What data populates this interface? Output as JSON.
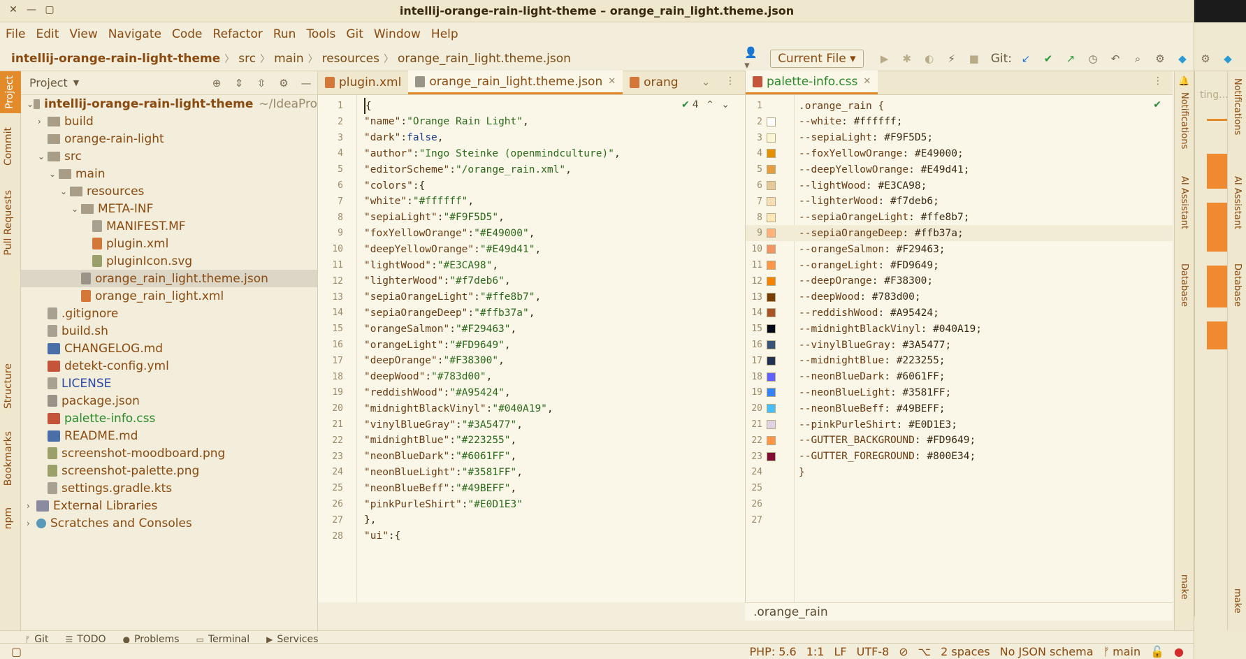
{
  "window": {
    "title": "intellij-orange-rain-light-theme – orange_rain_light.theme.json"
  },
  "menu": [
    "File",
    "Edit",
    "View",
    "Navigate",
    "Code",
    "Refactor",
    "Run",
    "Tools",
    "Git",
    "Window",
    "Help"
  ],
  "breadcrumb": {
    "project": "intellij-orange-rain-light-theme",
    "parts": [
      "src",
      "main",
      "resources"
    ],
    "file": "orange_rain_light.theme.json"
  },
  "toolbar": {
    "run_config": "Current File",
    "git_label": "Git:"
  },
  "left_stripe": [
    "Project",
    "Commit",
    "Pull Requests",
    "Structure",
    "Bookmarks",
    "npm"
  ],
  "project_panel": {
    "title": "Project",
    "rows": [
      {
        "depth": 0,
        "arrow": "v",
        "icon": "folder",
        "label": "intellij-orange-rain-light-theme",
        "suffix": "~/IdeaPro",
        "cls": "tl-brown tl-bold"
      },
      {
        "depth": 1,
        "arrow": ">",
        "icon": "folder",
        "label": "build",
        "cls": "tl-brown"
      },
      {
        "depth": 1,
        "arrow": "",
        "icon": "folder",
        "label": "orange-rain-light",
        "cls": "tl-brown"
      },
      {
        "depth": 1,
        "arrow": "v",
        "icon": "folder",
        "label": "src",
        "cls": "tl-brown"
      },
      {
        "depth": 2,
        "arrow": "v",
        "icon": "folder",
        "label": "main",
        "cls": "tl-brown"
      },
      {
        "depth": 3,
        "arrow": "v",
        "icon": "folder",
        "label": "resources",
        "cls": "tl-brown"
      },
      {
        "depth": 4,
        "arrow": "v",
        "icon": "folder",
        "label": "META-INF",
        "cls": "tl-brown"
      },
      {
        "depth": 5,
        "arrow": "",
        "icon": "file",
        "label": "MANIFEST.MF",
        "cls": "tl-brown"
      },
      {
        "depth": 5,
        "arrow": "",
        "icon": "xml",
        "label": "plugin.xml",
        "cls": "tl-brown"
      },
      {
        "depth": 5,
        "arrow": "",
        "icon": "img",
        "label": "pluginIcon.svg",
        "cls": "tl-brown"
      },
      {
        "depth": 4,
        "arrow": "",
        "icon": "json",
        "label": "orange_rain_light.theme.json",
        "cls": "tl-brown",
        "selected": true
      },
      {
        "depth": 4,
        "arrow": "",
        "icon": "xml",
        "label": "orange_rain_light.xml",
        "cls": "tl-brown"
      },
      {
        "depth": 1,
        "arrow": "",
        "icon": "file",
        "label": ".gitignore",
        "cls": "tl-brown"
      },
      {
        "depth": 1,
        "arrow": "",
        "icon": "file",
        "label": "build.sh",
        "cls": "tl-brown"
      },
      {
        "depth": 1,
        "arrow": "",
        "icon": "md",
        "label": "CHANGELOG.md",
        "cls": "tl-brown"
      },
      {
        "depth": 1,
        "arrow": "",
        "icon": "yml",
        "label": "detekt-config.yml",
        "cls": "tl-brown"
      },
      {
        "depth": 1,
        "arrow": "",
        "icon": "file",
        "label": "LICENSE",
        "cls": "tl-blue"
      },
      {
        "depth": 1,
        "arrow": "",
        "icon": "json",
        "label": "package.json",
        "cls": "tl-brown"
      },
      {
        "depth": 1,
        "arrow": "",
        "icon": "css",
        "label": "palette-info.css",
        "cls": "tl-green"
      },
      {
        "depth": 1,
        "arrow": "",
        "icon": "md",
        "label": "README.md",
        "cls": "tl-brown"
      },
      {
        "depth": 1,
        "arrow": "",
        "icon": "img",
        "label": "screenshot-moodboard.png",
        "cls": "tl-brown"
      },
      {
        "depth": 1,
        "arrow": "",
        "icon": "img",
        "label": "screenshot-palette.png",
        "cls": "tl-brown"
      },
      {
        "depth": 1,
        "arrow": "",
        "icon": "file",
        "label": "settings.gradle.kts",
        "cls": "tl-brown"
      },
      {
        "depth": 0,
        "arrow": ">",
        "icon": "lib",
        "label": "External Libraries",
        "cls": "tl-brown"
      },
      {
        "depth": 0,
        "arrow": ">",
        "icon": "scr",
        "label": "Scratches and Consoles",
        "cls": "tl-brown"
      }
    ]
  },
  "left_editor": {
    "tabs": [
      {
        "label": "plugin.xml",
        "icon": "#d4783a",
        "active": false,
        "close": false
      },
      {
        "label": "orange_rain_light.theme.json",
        "icon": "#9a9488",
        "active": true,
        "close": true
      },
      {
        "label": "orang",
        "icon": "#d4783a",
        "active": false,
        "close": false
      }
    ],
    "inspection_count": "4",
    "lines": [
      {
        "n": "1",
        "t": "{"
      },
      {
        "n": "2",
        "t": "  \"name\": \"Orange Rain Light\","
      },
      {
        "n": "3",
        "t": "  \"dark\": false,"
      },
      {
        "n": "4",
        "t": "  \"author\": \"Ingo Steinke (openmindculture)\","
      },
      {
        "n": "5",
        "t": "  \"editorScheme\": \"/orange_rain.xml\","
      },
      {
        "n": "6",
        "t": "  \"colors\": {"
      },
      {
        "n": "7",
        "t": "    \"white\": \"#ffffff\","
      },
      {
        "n": "8",
        "t": "    \"sepiaLight\": \"#F9F5D5\","
      },
      {
        "n": "9",
        "t": "    \"foxYellowOrange\": \"#E49000\","
      },
      {
        "n": "10",
        "t": "    \"deepYellowOrange\": \"#E49d41\","
      },
      {
        "n": "11",
        "t": "    \"lightWood\": \"#E3CA98\","
      },
      {
        "n": "12",
        "t": "    \"lighterWood\": \"#f7deb6\","
      },
      {
        "n": "13",
        "t": "    \"sepiaOrangeLight\": \"#ffe8b7\","
      },
      {
        "n": "14",
        "t": "    \"sepiaOrangeDeep\": \"#ffb37a\","
      },
      {
        "n": "15",
        "t": "    \"orangeSalmon\": \"#F29463\","
      },
      {
        "n": "16",
        "t": "    \"orangeLight\": \"#FD9649\","
      },
      {
        "n": "17",
        "t": "    \"deepOrange\": \"#F38300\","
      },
      {
        "n": "18",
        "t": "    \"deepWood\": \"#783d00\","
      },
      {
        "n": "19",
        "t": "    \"reddishWood\": \"#A95424\","
      },
      {
        "n": "20",
        "t": "    \"midnightBlackVinyl\": \"#040A19\","
      },
      {
        "n": "21",
        "t": "    \"vinylBlueGray\": \"#3A5477\","
      },
      {
        "n": "22",
        "t": "    \"midnightBlue\": \"#223255\","
      },
      {
        "n": "23",
        "t": "    \"neonBlueDark\": \"#6061FF\","
      },
      {
        "n": "24",
        "t": "    \"neonBlueLight\": \"#3581FF\","
      },
      {
        "n": "25",
        "t": "    \"neonBlueBeff\": \"#49BEFF\","
      },
      {
        "n": "26",
        "t": "    \"pinkPurleShirt\": \"#E0D1E3\""
      },
      {
        "n": "27",
        "t": "  },"
      },
      {
        "n": "28",
        "t": "  \"ui\": {"
      }
    ]
  },
  "right_editor": {
    "tabs": [
      {
        "label": "palette-info.css",
        "icon": "#c4553a",
        "active": true,
        "close": true
      }
    ],
    "footer": ".orange_rain",
    "lines": [
      {
        "n": "1",
        "t": ".orange_rain {",
        "sw": ""
      },
      {
        "n": "2",
        "t": "    --white: #ffffff;",
        "sw": "#ffffff"
      },
      {
        "n": "3",
        "t": "    --sepiaLight: #F9F5D5;",
        "sw": "#F9F5D5"
      },
      {
        "n": "4",
        "t": "    --foxYellowOrange: #E49000;",
        "sw": "#E49000"
      },
      {
        "n": "5",
        "t": "    --deepYellowOrange: #E49d41;",
        "sw": "#E49d41"
      },
      {
        "n": "6",
        "t": "    --lightWood: #E3CA98;",
        "sw": "#E3CA98"
      },
      {
        "n": "7",
        "t": "    --lighterWood: #f7deb6;",
        "sw": "#f7deb6"
      },
      {
        "n": "8",
        "t": "    --sepiaOrangeLight: #ffe8b7;",
        "sw": "#ffe8b7"
      },
      {
        "n": "9",
        "t": "    --sepiaOrangeDeep: #ffb37a;",
        "sw": "#ffb37a"
      },
      {
        "n": "10",
        "t": "    --orangeSalmon: #F29463;",
        "sw": "#F29463"
      },
      {
        "n": "11",
        "t": "    --orangeLight: #FD9649;",
        "sw": "#FD9649"
      },
      {
        "n": "12",
        "t": "    --deepOrange: #F38300;",
        "sw": "#F38300"
      },
      {
        "n": "13",
        "t": "    --deepWood: #783d00;",
        "sw": "#783d00"
      },
      {
        "n": "14",
        "t": "    --reddishWood: #A95424;",
        "sw": "#A95424"
      },
      {
        "n": "15",
        "t": "    --midnightBlackVinyl: #040A19;",
        "sw": "#040A19"
      },
      {
        "n": "16",
        "t": "    --vinylBlueGray: #3A5477;",
        "sw": "#3A5477"
      },
      {
        "n": "17",
        "t": "    --midnightBlue: #223255;",
        "sw": "#223255"
      },
      {
        "n": "18",
        "t": "    --neonBlueDark: #6061FF;",
        "sw": "#6061FF"
      },
      {
        "n": "19",
        "t": "    --neonBlueLight: #3581FF;",
        "sw": "#3581FF"
      },
      {
        "n": "20",
        "t": "    --neonBlueBeff: #49BEFF;",
        "sw": "#49BEFF"
      },
      {
        "n": "21",
        "t": "    --pinkPurleShirt: #E0D1E3;",
        "sw": "#E0D1E3"
      },
      {
        "n": "22",
        "t": "    --GUTTER_BACKGROUND: #FD9649;",
        "sw": "#FD9649"
      },
      {
        "n": "23",
        "t": "    --GUTTER_FOREGROUND: #800E34;",
        "sw": "#800E34"
      },
      {
        "n": "24",
        "t": "}",
        "sw": ""
      },
      {
        "n": "25",
        "t": "",
        "sw": ""
      },
      {
        "n": "26",
        "t": "",
        "sw": ""
      },
      {
        "n": "27",
        "t": "",
        "sw": ""
      }
    ]
  },
  "right_stripe": [
    "Notifications",
    "AI Assistant",
    "Database",
    "make"
  ],
  "side_window": {
    "partial_text": "ting..."
  },
  "bottom_tools": [
    "Git",
    "TODO",
    "Problems",
    "Terminal",
    "Services"
  ],
  "status": {
    "php": "PHP: 5.6",
    "pos": "1:1",
    "lf": "LF",
    "enc": "UTF-8",
    "indent": "2 spaces",
    "schema": "No JSON schema",
    "branch": "main"
  },
  "colors": {
    "accent": "#e38a2a",
    "background": "#f3eedb",
    "editor_bg": "#fbf7e8"
  }
}
